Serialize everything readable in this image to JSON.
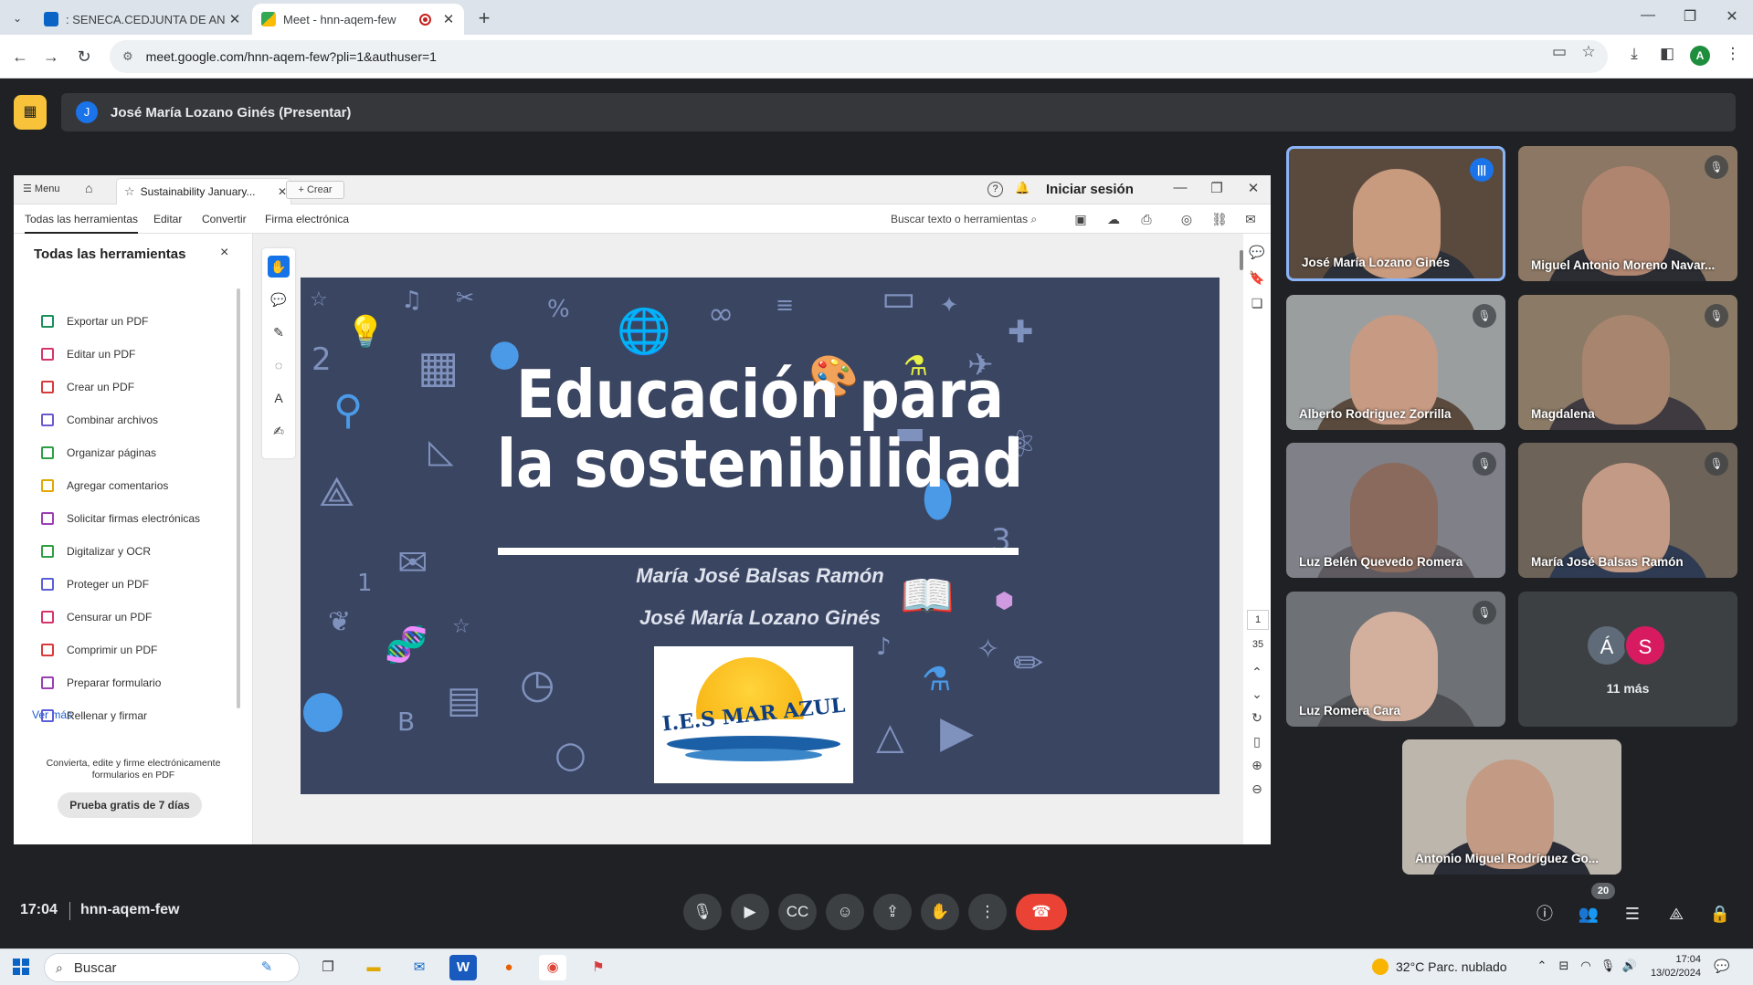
{
  "browser": {
    "tabs": [
      {
        "title": ": SENECA.CEDJUNTA DE ANDA",
        "favicon_color": "#0b63c5",
        "active": false
      },
      {
        "title": "Meet - hnn-aqem-few",
        "favicon_color": "#1e8e3e",
        "active": true,
        "recording": true
      }
    ],
    "url": "meet.google.com/hnn-aqem-few?pli=1&authuser=1",
    "profile_initial": "A"
  },
  "meet": {
    "presenter_initial": "J",
    "presenter_label": "José María Lozano Ginés (Presentar)",
    "time": "17:04",
    "meeting_code": "hnn-aqem-few",
    "participant_count": "20",
    "more_label": "11 más",
    "more_avatars": [
      {
        "initial": "Á",
        "color": "#5f6b78"
      },
      {
        "initial": "S",
        "color": "#d81b60"
      }
    ],
    "participants": [
      {
        "name": "José María Lozano Ginés",
        "speaking": true,
        "muted": false,
        "bg": "#5a4a3e",
        "face": "#c89a7e",
        "body": "#2c3038"
      },
      {
        "name": "Miguel Antonio Moreno Navar...",
        "speaking": false,
        "muted": true,
        "bg": "#8b7763",
        "face": "#b08570",
        "body": "#2b2d33"
      },
      {
        "name": "Alberto Rodriguez Zorrilla",
        "speaking": false,
        "muted": true,
        "bg": "#9a9e9f",
        "face": "#c79a83",
        "body": "#5a4a3d"
      },
      {
        "name": "Magdalena",
        "speaking": false,
        "muted": true,
        "bg": "#8a7a66",
        "face": "#a8856f",
        "body": "#3f3a40"
      },
      {
        "name": "Luz Belén Quevedo Romera",
        "speaking": false,
        "muted": true,
        "bg": "#7f8088",
        "face": "#8a6a5c",
        "body": "#5e5a60"
      },
      {
        "name": "María José Balsas Ramón",
        "speaking": false,
        "muted": true,
        "bg": "#6d6358",
        "face": "#c39a85",
        "body": "#2e3b52"
      },
      {
        "name": "Luz Romera Cara",
        "speaking": false,
        "muted": true,
        "bg": "#6e7176",
        "face": "#d2b09d",
        "body": "#4c4e52"
      },
      {
        "name": "Antonio Miguel Rodríguez Go...",
        "speaking": false,
        "muted": false,
        "bg": "#bdb6ad",
        "face": "#c39a83",
        "body": "#2a2d36"
      }
    ]
  },
  "acrobat": {
    "menu_label": "Menu",
    "doc_tab": "Sustainability January...",
    "create_label": "Crear",
    "signin_label": "Iniciar sesión",
    "menu_items": [
      "Todas las herramientas",
      "Editar",
      "Convertir",
      "Firma electrónica"
    ],
    "search_label": "Buscar texto o herramientas",
    "panel_title": "Todas las herramientas",
    "tools": [
      {
        "label": "Exportar un PDF",
        "color": "#1a8f5c"
      },
      {
        "label": "Editar un PDF",
        "color": "#d4366b"
      },
      {
        "label": "Crear un PDF",
        "color": "#d83b3b"
      },
      {
        "label": "Combinar archivos",
        "color": "#6a5acd"
      },
      {
        "label": "Organizar páginas",
        "color": "#2f9e44"
      },
      {
        "label": "Agregar comentarios",
        "color": "#e0a800"
      },
      {
        "label": "Solicitar firmas electrónicas",
        "color": "#9b3fb3"
      },
      {
        "label": "Digitalizar y OCR",
        "color": "#2f9e44"
      },
      {
        "label": "Proteger un PDF",
        "color": "#5b5fd6"
      },
      {
        "label": "Censurar un PDF",
        "color": "#d4366b"
      },
      {
        "label": "Comprimir un PDF",
        "color": "#d83b3b"
      },
      {
        "label": "Preparar formulario",
        "color": "#9b3fb3"
      },
      {
        "label": "Rellenar y firmar",
        "color": "#5b5fd6"
      }
    ],
    "see_more": "Ver más",
    "promo_text": "Convierta, edite y firme electrónicamente formularios en PDF",
    "trial_button": "Prueba gratis de 7 días",
    "page_current": "1",
    "page_total": "35"
  },
  "slide": {
    "title_line1": "Educación   para",
    "title_line2": "la sostenibilidad",
    "author1": "María José Balsas Ramón",
    "author2": "José María Lozano Ginés",
    "logo_text": "I.E.S MAR AZUL"
  },
  "taskbar": {
    "search_label": "Buscar",
    "weather": "32°C  Parc. nublado",
    "clock_time": "17:04",
    "clock_date": "13/02/2024"
  }
}
